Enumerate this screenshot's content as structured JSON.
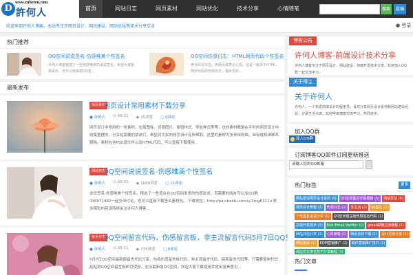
{
  "header": {
    "logo_url": "www.xuheren.com",
    "logo_name": "許何人",
    "logo_mark": "D",
    "nav": [
      "首页",
      "网站日志",
      "网页素材",
      "网站优化",
      "技术分享",
      "心情随笔"
    ],
    "search_button": "搜索",
    "submit_button": "投稿"
  },
  "notice": {
    "text": "欢迎来到许何人博客，本站专注于网页设计、网站建设、网站优化等技术分享交流",
    "user_icon": "user-icon",
    "user_label": "登录"
  },
  "recommend": {
    "heading": "热门推荐",
    "items": [
      {
        "title": "QQ空间说说签名-伤感唯美个性签名",
        "desc": "许何人博客整理了一些伤感唯美的说说签名，希望大家能够喜欢，也可以用来做QQ签..."
      },
      {
        "title": "QQ空间伤感日志：HTML网页代码个性签名",
        "desc": "用代码写日志，用网页来表达心情。这是一篇关于HTML网页代码的伤感日志，程序员的..."
      }
    ]
  },
  "latest": {
    "heading": "最新发布",
    "posts": [
      {
        "category": "网页素材",
        "title": "网页设计常用素材下载分享",
        "author": "许何人",
        "date": "06-21",
        "views": "35浏览",
        "comments": "0评论",
        "excerpt": "网页设计中常用的一些素材，包括图标、背景图片、按钮样式、导航样式等等，这些素材都是在平时的网页设计中收集整理的，分享给需要的朋友们，希望对大家的网页设计有所帮助。这里的素材大多来自网络，如有侵权请联系删除。素材包含PSD源文件以及HTML代码，可以直接下载使用..."
      },
      {
        "category": "网站日志",
        "title": "QQ空间说说签名-伤感唯美个性签名",
        "author": "许何人",
        "date": "05-23",
        "views": "1089浏览",
        "comments": "11评论",
        "excerpt": "说说签名-伤感唯美个性签名，精选了一些适合在QQ空间发表的伤感说说，有需要的朋友可以加QQ群438971482一起交流讨论，也可以直接下载签名素材包。 下载地址：http://pan.baidu.com/s/1mgE411u 更多精彩内容请持续关注许何人博客..."
      },
      {
        "category": "技术分享",
        "title": "QQ空间留言代码，伤感留言板，非主流留言代码5月7日QQ空间最新版代码分享",
        "author": "许何人",
        "date": "05-11",
        "views": "735浏览",
        "comments": "8评论",
        "excerpt": "5月7日QQ空间最新版留言代码分享，包括伤感留言板代码、非主流留言代码、搞笑留言代码等，只需要复制代码粘贴到QQ空间留言板即可使用，支持最新版QQ空间，欢迎大家下载使用并提出宝贵意见..."
      }
    ]
  },
  "sidebar": {
    "notice_widget": {
      "tag": "博客公告",
      "title": "许何人博客-前端设计技术分享",
      "text": "许何人博客专注于网页设计、网站建设、前端开发技术分享，欢迎加入QQ群一起交流学习。"
    },
    "about_widget": {
      "tag": "关于博主",
      "title": "关于许何人",
      "text": "许何人，一个热爱前端设计的程序员，喜欢分享网页设计素材和网站建设经验，记录生活点滴，欢迎常来博客交流学习，共同进步。"
    },
    "qq_widget": {
      "heading": "加入QQ群",
      "button": "加入QQ群"
    },
    "subscribe_widget": {
      "heading": "订阅博客QQ邮件订阅更新推送",
      "placeholder": "请输入您的QQ邮箱"
    },
    "tags_widget": {
      "heading": "热门标签",
      "more": "更多",
      "tags": [
        {
          "label": "网站建设网页设计素材 (6)",
          "color": "#3f93d6"
        },
        {
          "label": "QQ空间留言代码模板 (5)",
          "color": "#a35cd6"
        },
        {
          "label": "网站优化 (4)",
          "color": "#e0483e"
        },
        {
          "label": "网页设计教程 (3)",
          "color": "#3f93d6"
        },
        {
          "label": "伤感日志 (2)",
          "color": "#a35cd6"
        },
        {
          "label": "非主流 (2)",
          "color": "#e0483e"
        },
        {
          "label": "qq签名 (2)",
          "color": "#f0a030"
        },
        {
          "label": "个性签名说说分享 (1)",
          "color": "#e77e23"
        },
        {
          "label": "QQ空间留言板伤感签名代码 (1)",
          "color": "#555555"
        },
        {
          "label": "前端开发技术 (1)",
          "color": "#3f93d6"
        },
        {
          "label": "Fast Email Verifier (1)",
          "color": "#2eaa6e"
        },
        {
          "label": "gmail邮箱注册教程 (1)",
          "color": "#e0483e"
        },
        {
          "label": "网站日志分享 (1)",
          "color": "#2d8bd8"
        },
        {
          "label": "心情随笔 (1)",
          "color": "#a35cd6"
        },
        {
          "label": "网页素材下载 (1)",
          "color": "#3f93d6"
        },
        {
          "label": "设计灵感分享 (1)",
          "color": "#e77e23"
        },
        {
          "label": "网站建设 (1)",
          "color": "#f0a030"
        },
        {
          "label": "EDM营销推广 (1)",
          "color": "#555555"
        },
        {
          "label": "邮件营销推广技巧 (1)",
          "color": "#3f93d6"
        },
        {
          "label": "网站优化排名技巧分享教程 (1)",
          "color": "#2eaa6e"
        }
      ]
    },
    "hot_widget": {
      "heading": "热门文章"
    }
  }
}
